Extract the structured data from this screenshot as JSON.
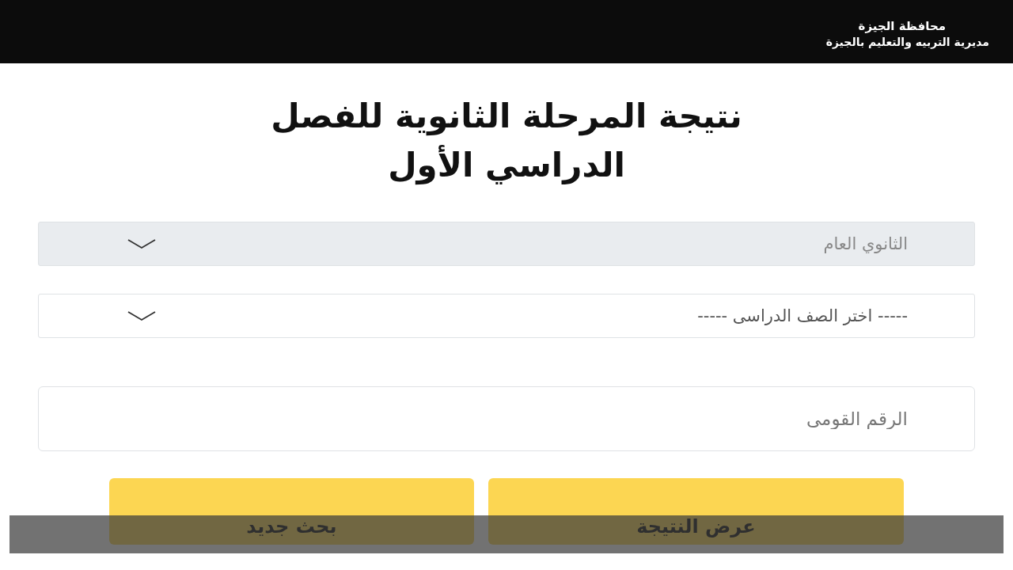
{
  "header": {
    "lines": [
      "محافظة الجيزة",
      "مديرية التربيه والتعليم بالجيزة"
    ]
  },
  "title_lines": [
    "نتيجة المرحلة الثانوية للفصل",
    "الدراسي الأول"
  ],
  "selects": [
    {
      "value": "الثانوي العام",
      "disabled": true
    },
    {
      "value": "----- اختر الصف الدراسى -----",
      "disabled": false
    }
  ],
  "national_id": {
    "placeholder": "الرقم القومى"
  },
  "buttons": [
    {
      "label": "عرض النتيجة"
    },
    {
      "label": "بحث جديد"
    }
  ],
  "overlay_band": {
    "visible": true
  }
}
